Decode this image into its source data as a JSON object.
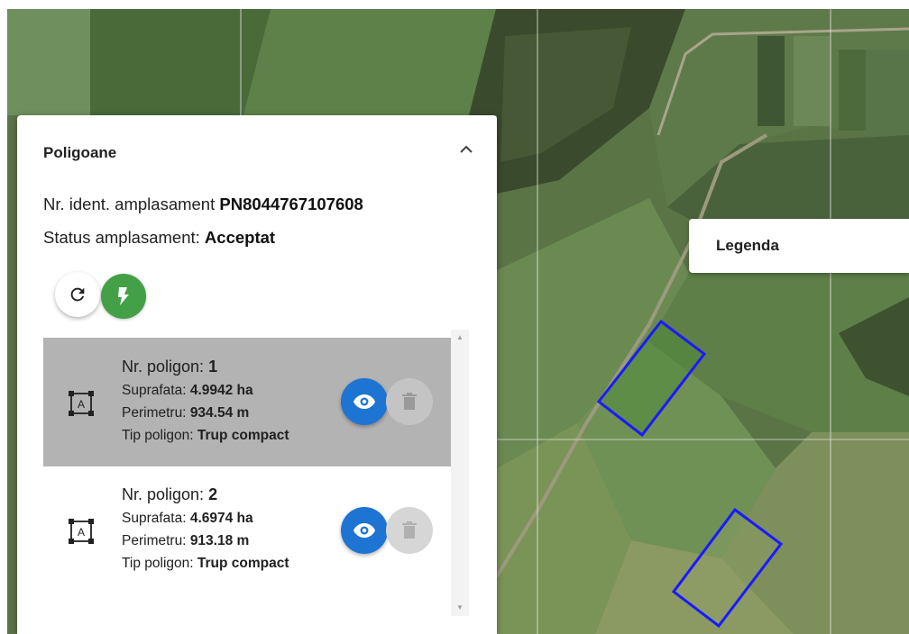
{
  "map": {
    "type": "satellite",
    "polygon_color": "#1a1aff",
    "polygons_drawn": 2
  },
  "poligoane_panel": {
    "title": "Poligoane",
    "collapse_icon": "chevron-up-icon",
    "ident_label": "Nr. ident. amplasament",
    "ident_value": "PN8044767107608",
    "status_label": "Status amplasament:",
    "status_value": "Acceptat",
    "refresh_icon": "refresh-icon",
    "bolt_icon": "bolt-icon",
    "accent_green": "#43a047",
    "accent_blue": "#1e74d2",
    "polygons": [
      {
        "number_label": "Nr. poligon:",
        "number": "1",
        "area_label": "Suprafata:",
        "area": "4.9942 ha",
        "perimeter_label": "Perimetru:",
        "perimeter": "934.54 m",
        "type_label": "Tip poligon:",
        "type": "Trup compact",
        "selected": true
      },
      {
        "number_label": "Nr. poligon:",
        "number": "2",
        "area_label": "Suprafata:",
        "area": "4.6974 ha",
        "perimeter_label": "Perimetru:",
        "perimeter": "913.18 m",
        "type_label": "Tip poligon:",
        "type": "Trup compact",
        "selected": false
      }
    ]
  },
  "legend_panel": {
    "title": "Legenda"
  }
}
